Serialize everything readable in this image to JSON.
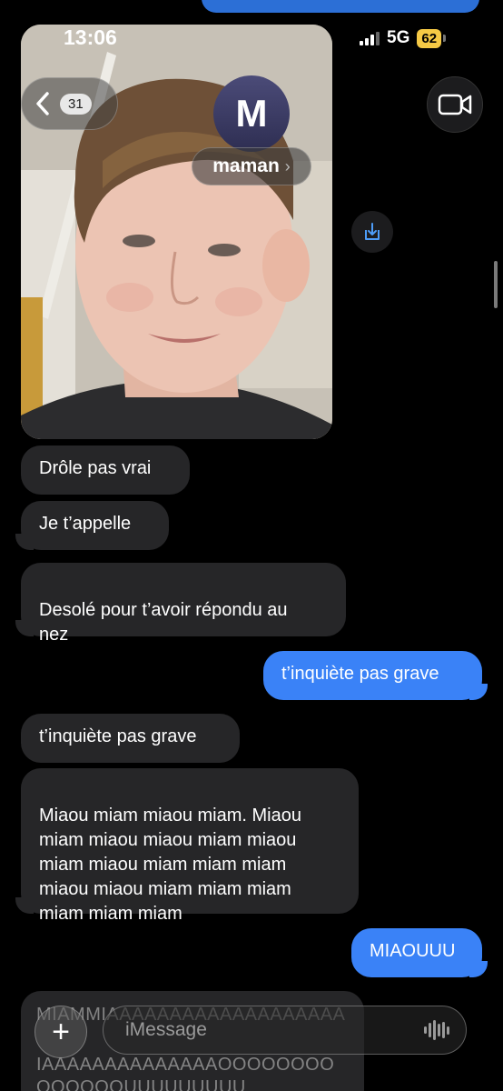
{
  "status": {
    "time": "13:06",
    "network": "5G",
    "battery": "62"
  },
  "header": {
    "back_count": "31",
    "avatar_initial": "M",
    "contact_name": "maman"
  },
  "messages": [
    {
      "from": "them",
      "text": "Drôle pas vrai"
    },
    {
      "from": "them",
      "text": "Je t’appelle"
    },
    {
      "from": "them",
      "text": "Desolé pour t’avoir répondu au\nnez"
    },
    {
      "from": "me",
      "text": "t’inquiète pas grave"
    },
    {
      "from": "them",
      "text": "t’inquiète pas grave"
    },
    {
      "from": "them",
      "text": "Miaou miam miaou miam. Miaou\nmiam miaou miaou miam miaou\nmiam miaou miam miam miam\nmiaou miaou miam miam miam\nmiam miam miam"
    },
    {
      "from": "me",
      "text": "MIAOUUU"
    }
  ],
  "partial_message": {
    "line1": "MIAMMIAAAAAAAAAAAAAAAAAAA",
    "line2": "IAAAAAAAAAAAAAAOOOOOOOO",
    "line3": "OOOOOOUUUUUUUUU"
  },
  "composer": {
    "placeholder": "iMessage"
  },
  "colors": {
    "sent_bubble": "#3a82f7",
    "received_bubble": "#262628",
    "background": "#000000"
  }
}
